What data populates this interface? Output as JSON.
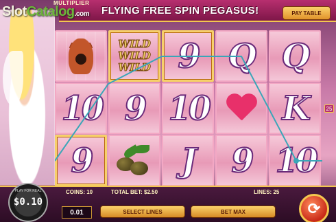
{
  "watermark": {
    "brand_a": "Slot",
    "brand_b": "Catalog",
    "domain": ".com"
  },
  "header": {
    "multiplier_label": "MULTIPLIER",
    "feature_title": "FLYING FREE SPIN PEGASUS!",
    "paytable_label": "PAY TABLE"
  },
  "reels": [
    [
      "vase",
      "10",
      "9"
    ],
    [
      "WILD",
      "9",
      "olives"
    ],
    [
      "9",
      "10",
      "J"
    ],
    [
      "Q",
      "heart",
      "9"
    ],
    [
      "Q",
      "K",
      "10"
    ]
  ],
  "wild_words": [
    "WILD",
    "WILD",
    "WILD"
  ],
  "side_numbers": {
    "right": "25"
  },
  "footer": {
    "coins_label": "COINS:",
    "coins_value": "10",
    "total_bet_label": "TOTAL BET:",
    "total_bet_value": "$2.50",
    "lines_label": "LINES:",
    "lines_value": "25",
    "coin_value": "0.01",
    "select_lines_label": "SELECT LINES",
    "bet_max_label": "BET MAX"
  },
  "play_for_real": {
    "label": "PLAY FOR REAL",
    "amount": "$0.10"
  },
  "colors": {
    "accent_gold": "#f3c74f",
    "banner_pink": "#b72f6f",
    "payline": "#3aa6b8"
  }
}
